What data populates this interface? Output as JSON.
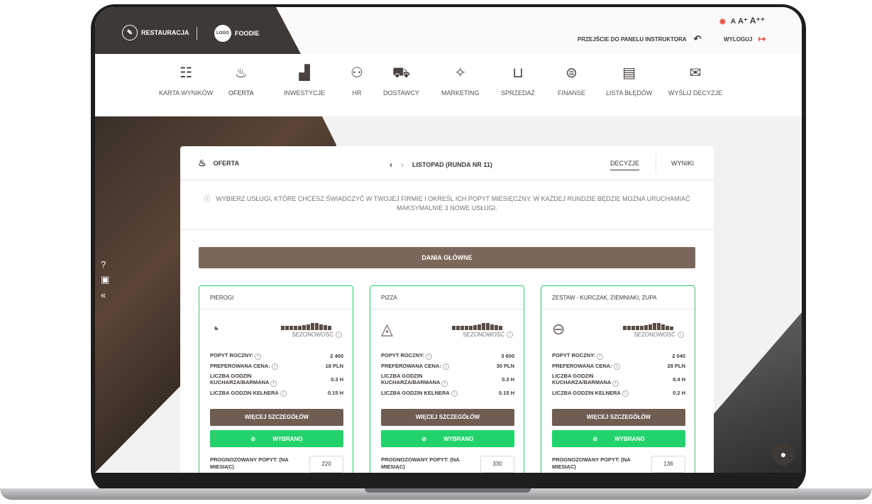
{
  "header": {
    "brand1": "RESTAURACJA",
    "logo": "LOGO",
    "brand2": "FOODIE",
    "instructor_link": "PRZEJŚCIE DO PANELU INSTRUKTORA",
    "logout": "WYLOGUJ",
    "font_small": "A",
    "font_medium": "A⁺",
    "font_large": "A⁺⁺"
  },
  "nav": [
    {
      "label": "KARTA WYNIKÓW",
      "icon": "scorecard-icon"
    },
    {
      "label": "OFERTA",
      "icon": "offer-icon"
    },
    {
      "label": "INWESTYCJE",
      "icon": "investments-icon"
    },
    {
      "label": "HR",
      "icon": "people-icon"
    },
    {
      "label": "DOSTAWCY",
      "icon": "truck-icon"
    },
    {
      "label": "MARKETING",
      "icon": "megaphone-icon"
    },
    {
      "label": "SPRZEDAŻ",
      "icon": "basket-icon"
    },
    {
      "label": "FINANSE",
      "icon": "coins-icon"
    },
    {
      "label": "LISTA BŁĘDÓW",
      "icon": "list-icon"
    },
    {
      "label": "WYŚLIJ DECYZJE",
      "icon": "send-icon"
    }
  ],
  "panel": {
    "title": "OFERTA",
    "round": "LISTOPAD (RUNDA NR 11)",
    "tab_decisions": "DECYZJE",
    "tab_results": "WYNIKI",
    "info": "WYBIERZ USŁUGI, KTÓRE CHCESZ ŚWIADCZYĆ W TWOJEJ FIRMIE I OKREŚL ICH POPYT MIESIĘCZNY. W KAŻDEJ RUNDZIE BĘDZIE MOŻNA URUCHAMIAĆ MAKSYMALNIE 3 NOWE USŁUGI.",
    "section": "DANIA GŁÓWNE"
  },
  "labels": {
    "season": "SEZONOWOŚĆ",
    "annual": "POPYT ROCZNY:",
    "price": "PREFEROWANA CENA:",
    "cook_hours": "LICZBA GODZIN KUCHARZA/BARMANA",
    "waiter_hours": "LICZBA GODZIN KELNERA",
    "more": "WIĘCEJ SZCZEGÓŁÓW",
    "selected": "WYBRANO",
    "forecast": "PROGNOZOWANY POPYT: (NA MIESIĄC)"
  },
  "cards": [
    {
      "name": "PIEROGI",
      "annual": "2 400",
      "price": "18 PLN",
      "cook": "0.3 H",
      "waiter": "0.15 H",
      "forecast": "220",
      "seasonality": [
        0.6,
        0.6,
        0.6,
        0.6,
        0.6,
        0.7,
        0.8,
        1,
        1,
        0.8,
        0.7,
        0.6
      ]
    },
    {
      "name": "PIZZA",
      "annual": "3 600",
      "price": "30 PLN",
      "cook": "0.3 H",
      "waiter": "0.15 H",
      "forecast": "330",
      "seasonality": [
        0.6,
        0.6,
        0.6,
        0.6,
        0.6,
        0.7,
        0.8,
        1,
        1,
        0.8,
        0.7,
        0.6
      ]
    },
    {
      "name": "ZESTAW - KURCZAK, ZIEMNIAKI, ZUPA",
      "annual": "2 040",
      "price": "28 PLN",
      "cook": "0.4 H",
      "waiter": "0.2 H",
      "forecast": "136",
      "seasonality": [
        0.6,
        0.6,
        0.6,
        0.6,
        0.6,
        0.7,
        0.8,
        1,
        1,
        0.8,
        0.6,
        0.5
      ]
    }
  ],
  "colors": {
    "accent_green": "#22d36b",
    "brown": "#6f5d52",
    "dark": "#3f3935",
    "logout_red": "#e74c3c"
  }
}
